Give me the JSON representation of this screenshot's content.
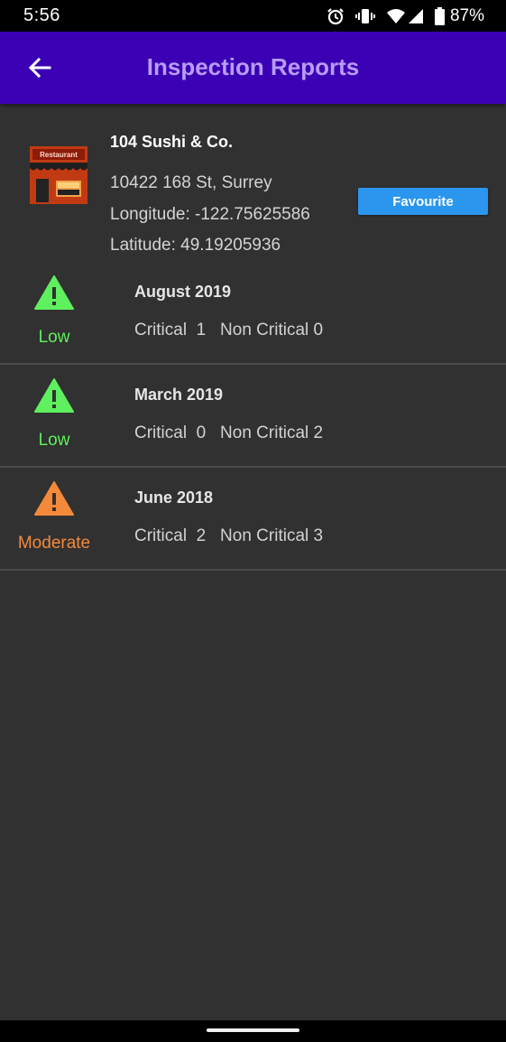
{
  "status_bar": {
    "time": "5:56",
    "battery": "87%",
    "icons": [
      "alarm-icon",
      "vibrate-icon",
      "wifi-icon",
      "signal-icon",
      "battery-icon"
    ]
  },
  "app_bar": {
    "title": "Inspection Reports",
    "back_icon": "back-arrow-icon",
    "background": "#3b00b3",
    "title_color": "#b79cf8"
  },
  "restaurant": {
    "name": "104 Sushi & Co.",
    "address": "10422 168 St, Surrey",
    "longitude": "Longitude: -122.75625586",
    "latitude": "Latitude: 49.19205936",
    "icon": "restaurant-storefront-icon",
    "icon_sign_text": "Restaurant",
    "favourite_label": "Favourite",
    "favourite_color": "#2b96ee"
  },
  "inspections": [
    {
      "date": "August 2019",
      "hazard": "Low",
      "hazard_color": "#5ef05e",
      "critical_label": "Critical",
      "critical": "1",
      "non_critical_label": "Non Critical",
      "non_critical": "0"
    },
    {
      "date": "March 2019",
      "hazard": "Low",
      "hazard_color": "#5ef05e",
      "critical_label": "Critical",
      "critical": "0",
      "non_critical_label": "Non Critical",
      "non_critical": "2"
    },
    {
      "date": "June 2018",
      "hazard": "Moderate",
      "hazard_color": "#f5893a",
      "critical_label": "Critical",
      "critical": "2",
      "non_critical_label": "Non Critical",
      "non_critical": "3"
    }
  ]
}
